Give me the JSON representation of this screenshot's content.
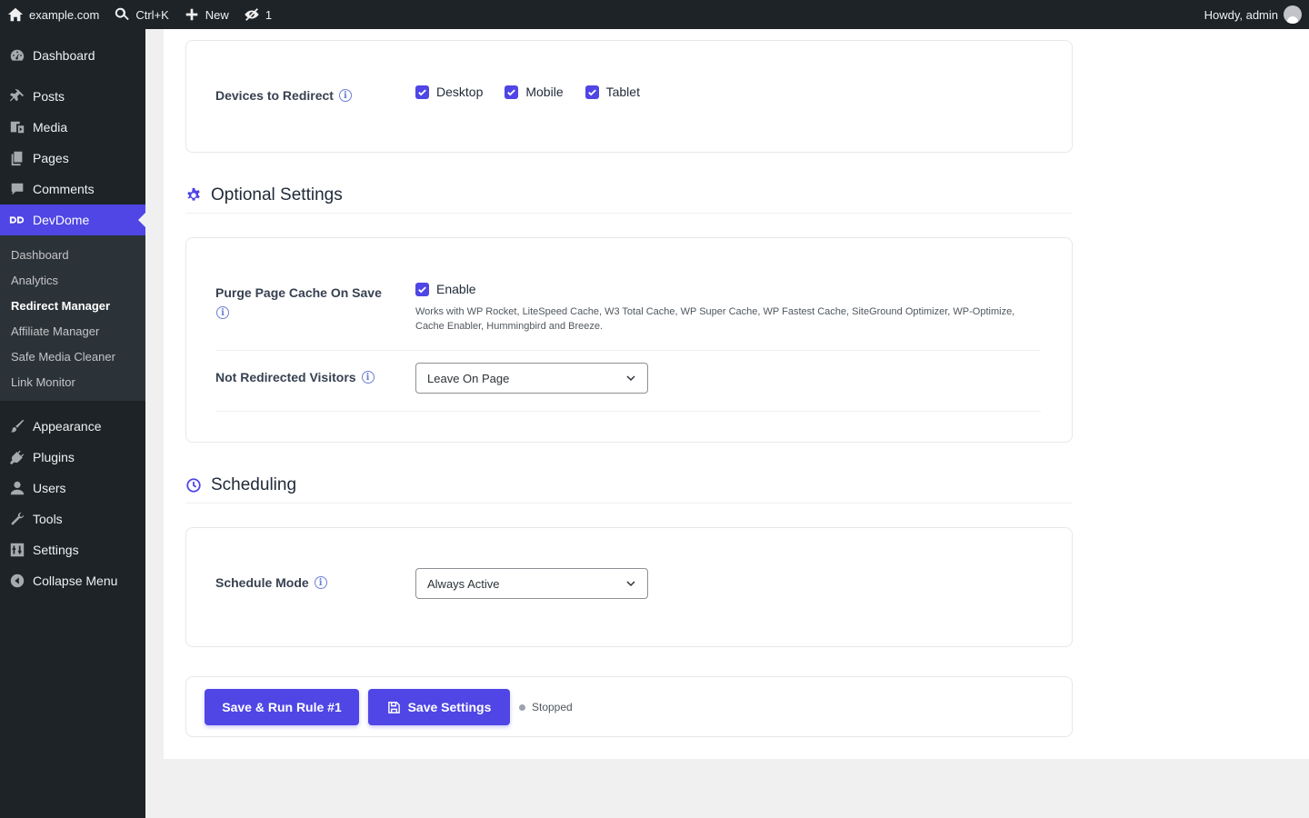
{
  "adminbar": {
    "site": "example.com",
    "search_shortcut": "Ctrl+K",
    "new_label": "New",
    "hidden_count": "1",
    "greeting": "Howdy, admin"
  },
  "sidebar": {
    "items": [
      {
        "label": "Dashboard"
      },
      {
        "label": "Posts"
      },
      {
        "label": "Media"
      },
      {
        "label": "Pages"
      },
      {
        "label": "Comments"
      },
      {
        "label": "DevDome"
      },
      {
        "label": "Appearance"
      },
      {
        "label": "Plugins"
      },
      {
        "label": "Users"
      },
      {
        "label": "Tools"
      },
      {
        "label": "Settings"
      },
      {
        "label": "Collapse Menu"
      }
    ],
    "submenu": [
      {
        "label": "Dashboard"
      },
      {
        "label": "Analytics"
      },
      {
        "label": "Redirect Manager"
      },
      {
        "label": "Affiliate Manager"
      },
      {
        "label": "Safe Media Cleaner"
      },
      {
        "label": "Link Monitor"
      }
    ]
  },
  "devices": {
    "label": "Devices to Redirect",
    "options": [
      {
        "label": "Desktop",
        "checked": true
      },
      {
        "label": "Mobile",
        "checked": true
      },
      {
        "label": "Tablet",
        "checked": true
      }
    ]
  },
  "optional": {
    "title": "Optional Settings",
    "purge_label": "Purge Page Cache On Save",
    "purge_enable": "Enable",
    "purge_help": "Works with WP Rocket, LiteSpeed Cache, W3 Total Cache, WP Super Cache, WP Fastest Cache, SiteGround Optimizer, WP-Optimize, Cache Enabler, Hummingbird and Breeze.",
    "not_redirected_label": "Not Redirected Visitors",
    "not_redirected_value": "Leave On Page"
  },
  "scheduling": {
    "title": "Scheduling",
    "mode_label": "Schedule Mode",
    "mode_value": "Always Active"
  },
  "actions": {
    "save_run": "Save & Run Rule #1",
    "save_settings": "Save Settings",
    "status": "Stopped"
  },
  "colors": {
    "accent": "#4f46e5",
    "sidebar_bg": "#1d2327",
    "submenu_bg": "#2c3338"
  }
}
